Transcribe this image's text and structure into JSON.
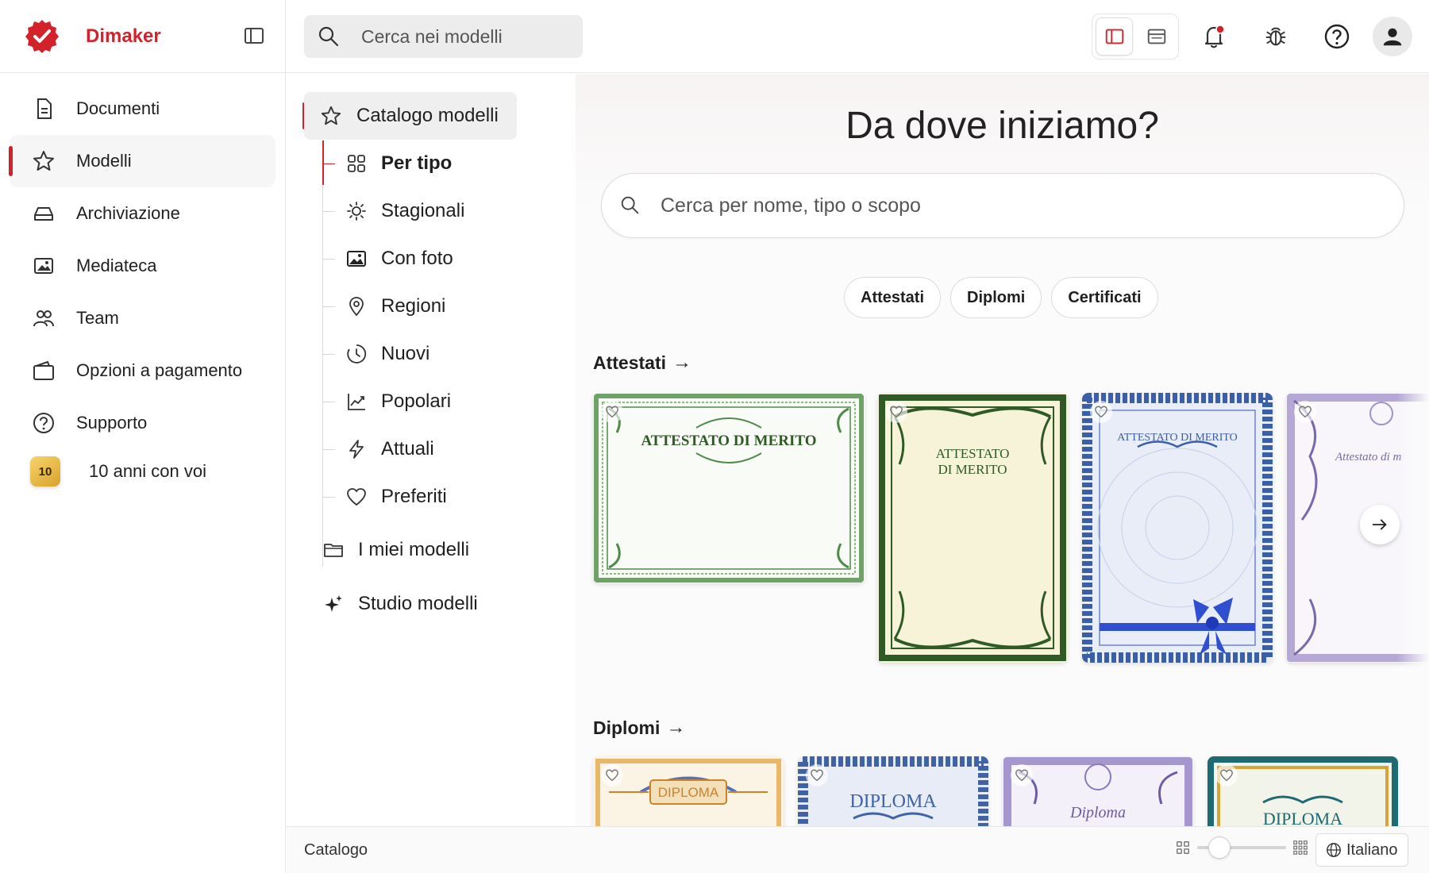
{
  "app": {
    "name": "Dimaker",
    "accent": "#d3222a"
  },
  "sidebar": {
    "items": [
      {
        "label": "Documenti",
        "icon": "document-icon"
      },
      {
        "label": "Modelli",
        "icon": "star-icon",
        "active": true
      },
      {
        "label": "Archiviazione",
        "icon": "storage-icon"
      },
      {
        "label": "Mediateca",
        "icon": "media-icon"
      },
      {
        "label": "Team",
        "icon": "team-icon"
      },
      {
        "label": "Opzioni a pagamento",
        "icon": "wallet-icon"
      },
      {
        "label": "Supporto",
        "icon": "help-icon"
      }
    ],
    "anniversary": {
      "badge": "10",
      "label": "10 anni con voi"
    }
  },
  "topbar": {
    "search_placeholder": "Cerca nei modelli"
  },
  "catalog_nav": {
    "header": "Catalogo modelli",
    "items": [
      {
        "label": "Per tipo",
        "icon": "grid-icon"
      },
      {
        "label": "Stagionali",
        "icon": "sun-icon"
      },
      {
        "label": "Con foto",
        "icon": "image-icon"
      },
      {
        "label": "Regioni",
        "icon": "location-pin-icon"
      },
      {
        "label": "Nuovi",
        "icon": "clock-icon"
      },
      {
        "label": "Popolari",
        "icon": "trending-icon"
      },
      {
        "label": "Attuali",
        "icon": "lightning-icon"
      },
      {
        "label": "Preferiti",
        "icon": "heart-icon"
      }
    ],
    "my_templates": "I miei modelli",
    "studio": "Studio modelli"
  },
  "main": {
    "headline": "Da dove iniziamo?",
    "search_placeholder": "Cerca per nome, tipo o scopo",
    "chips": [
      "Attestati",
      "Diplomi",
      "Certificati"
    ],
    "sections": [
      {
        "title": "Attestati",
        "cards": [
          {
            "text": "ATTESTATO DI MERITO",
            "color": "#4f8a4a"
          },
          {
            "text_lines": [
              "ATTESTATO",
              "DI MERITO"
            ],
            "color": "#2f5a25"
          },
          {
            "text": "ATTESTATO DI MERITO",
            "color": "#3a5ea8"
          },
          {
            "text": "Attestato di m",
            "color": "#7a68ad"
          }
        ]
      },
      {
        "title": "Diplomi",
        "cards": [
          {
            "text": "DIPLOMA",
            "color": "#c9842b"
          },
          {
            "text": "DIPLOMA",
            "color": "#3f63a5"
          },
          {
            "text": "Diploma",
            "color": "#6f5aa6"
          },
          {
            "text": "DIPLOMA",
            "color": "#1e6a73"
          }
        ]
      }
    ]
  },
  "statusbar": {
    "label": "Catalogo",
    "language": "Italiano"
  }
}
